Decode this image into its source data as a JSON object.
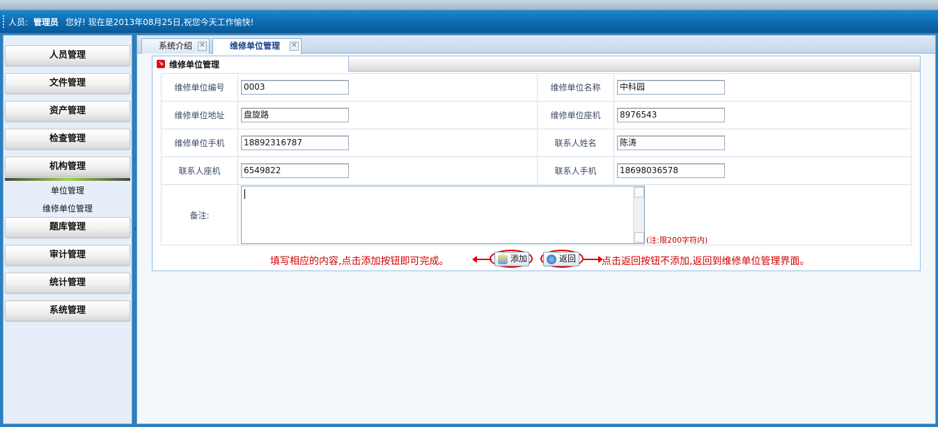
{
  "header": {
    "user_prefix": "人员:",
    "user_name": "管理员",
    "greeting": "您好!  现在是2013年08月25日,祝您今天工作愉快!"
  },
  "sidebar": {
    "menus": [
      {
        "label": "人员管理"
      },
      {
        "label": "文件管理"
      },
      {
        "label": "资产管理"
      },
      {
        "label": "检查管理"
      },
      {
        "label": "机构管理"
      },
      {
        "label": "题库管理"
      },
      {
        "label": "审计管理"
      },
      {
        "label": "统计管理"
      },
      {
        "label": "系统管理"
      }
    ],
    "active_menu": "机构管理",
    "sub_items": [
      {
        "label": "单位管理"
      },
      {
        "label": "维修单位管理"
      }
    ],
    "collapse_glyph": "«"
  },
  "tabs": [
    {
      "label": "系统介绍",
      "active": false
    },
    {
      "label": "维修单位管理",
      "active": true
    }
  ],
  "panel": {
    "title": "维修单位管理"
  },
  "form": {
    "code": {
      "label": "维修单位编号",
      "value": "0003"
    },
    "name": {
      "label": "维修单位名称",
      "value": "中科园"
    },
    "address": {
      "label": "维修单位地址",
      "value": "盘旋路"
    },
    "landline": {
      "label": "维修单位座机",
      "value": "8976543"
    },
    "mobile": {
      "label": "维修单位手机",
      "value": "18892316787"
    },
    "contact_name": {
      "label": "联系人姓名",
      "value": "陈涛"
    },
    "contact_landline": {
      "label": "联系人座机",
      "value": "6549822"
    },
    "contact_mobile": {
      "label": "联系人手机",
      "value": "18698036578"
    },
    "remark": {
      "label": "备注:",
      "value": "",
      "hint": "(注:限200字符内)"
    }
  },
  "actions": {
    "add_label": "添加",
    "back_label": "返回"
  },
  "annotations": {
    "left": "填写相应的内容,点击添加按钮即可完成。",
    "right": "点击返回按钮不添加,返回到维修单位管理界面。"
  },
  "colors": {
    "header_blue": "#0f6fb4",
    "annotation_red": "#d00000",
    "link_blue": "#15428b"
  }
}
